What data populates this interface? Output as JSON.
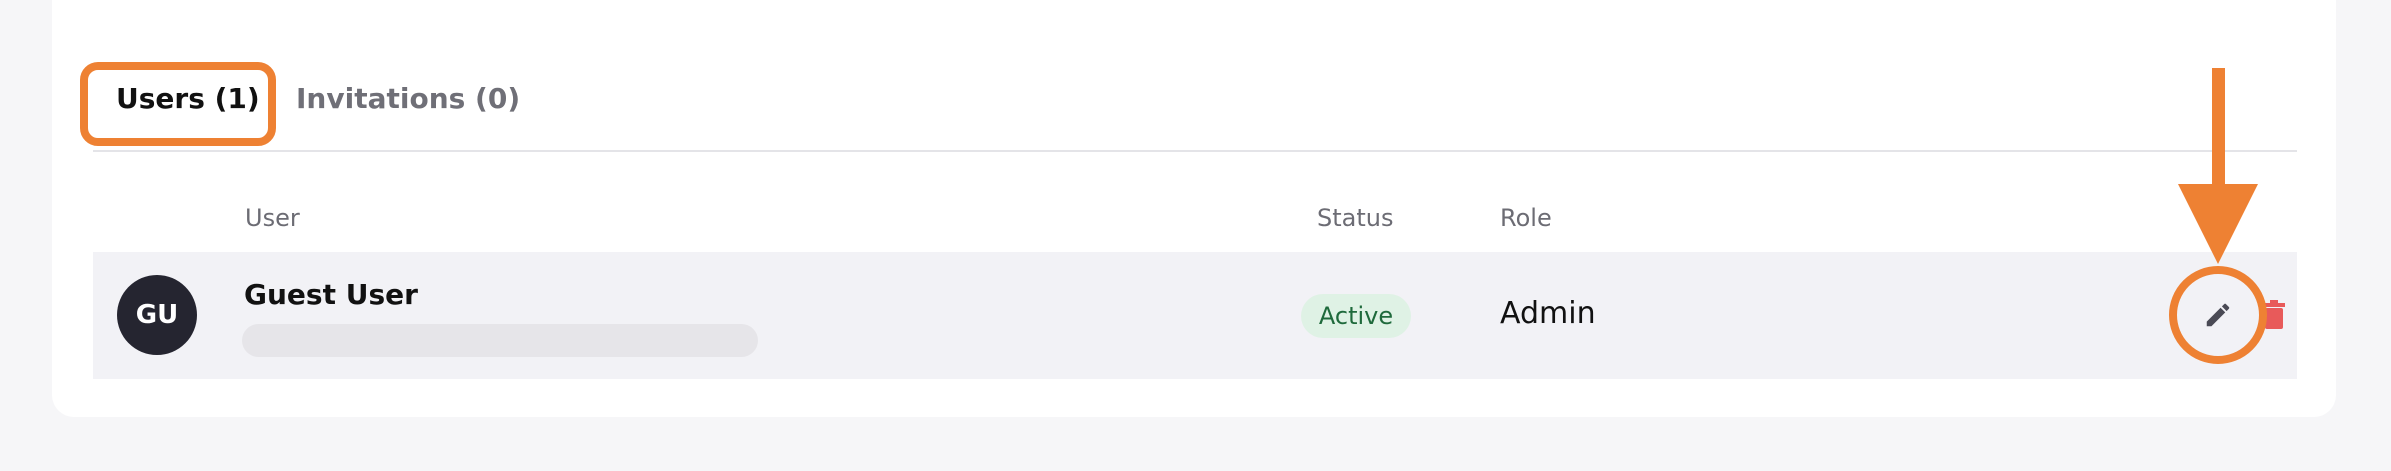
{
  "tabs": [
    {
      "label": "Users (1)",
      "active": true
    },
    {
      "label": "Invitations (0)",
      "active": false
    }
  ],
  "table": {
    "columns": {
      "user": "User",
      "status": "Status",
      "role": "Role"
    },
    "rows": [
      {
        "avatar_initials": "GU",
        "name": "Guest User",
        "status": "Active",
        "role": "Admin"
      }
    ]
  },
  "icons": {
    "edit": "pencil-icon",
    "delete": "trash-icon"
  },
  "colors": {
    "annotation": "#ee8133",
    "status_active_bg": "#dff2e5",
    "status_active_text": "#1f6a3c",
    "delete": "#e85a5a",
    "avatar_bg": "#252530"
  }
}
